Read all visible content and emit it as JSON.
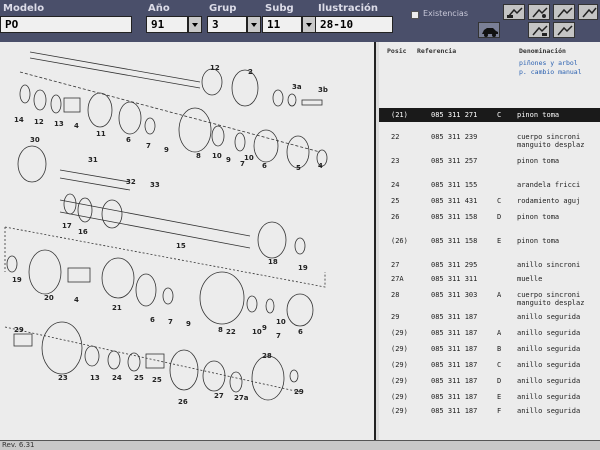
{
  "header": {
    "modelo_label": "Modelo",
    "modelo_value": "PO",
    "ano_label": "Año",
    "ano_value": "91",
    "grup_label": "Grup",
    "grup_value": "3",
    "subg_label": "Subg",
    "subg_value": "11",
    "ilustracion_label": "Ilustración",
    "ilustracion_value": "28-10",
    "existencias_label": "Existencias",
    "toolbar_icons": [
      "car-parts-icon-1",
      "car-parts-icon-2",
      "car-parts-icon-3",
      "car-parts-icon-4",
      "car-parts-icon-5",
      "car-parts-icon-6",
      "car-icon"
    ]
  },
  "drawing": {
    "callouts": [
      "12",
      "2",
      "3a",
      "3b",
      "14",
      "12",
      "13",
      "4",
      "11",
      "6",
      "7",
      "9",
      "8",
      "10",
      "10",
      "9",
      "7",
      "6",
      "5",
      "4",
      "30",
      "31",
      "32",
      "33",
      "17",
      "16",
      "15",
      "18",
      "19",
      "19",
      "20",
      "4",
      "21",
      "6",
      "7",
      "9",
      "8",
      "10",
      "22",
      "10",
      "9",
      "7",
      "6",
      "29",
      "23",
      "13",
      "24",
      "25",
      "28",
      "26",
      "27",
      "27a",
      "29",
      "25"
    ]
  },
  "parts": {
    "header": {
      "pos": "Posic",
      "ref": "Referencia",
      "den": "Denominación"
    },
    "group_desc": [
      "piñones y arbol",
      "p. cambio manual"
    ],
    "rows": [
      {
        "pos": "(21)",
        "ref": "085 311 271",
        "suf": "C",
        "den": "pinon toma",
        "den2": "",
        "selected": true
      },
      {
        "pos": "22",
        "ref": "085 311 239",
        "suf": "",
        "den": "cuerpo sincroni",
        "den2": "manguito desplaz",
        "selected": false
      },
      {
        "pos": "23",
        "ref": "085 311 257",
        "suf": "",
        "den": "pinon toma",
        "den2": "",
        "selected": false
      },
      {
        "pos": "24",
        "ref": "085 311 155",
        "suf": "",
        "den": "arandela fricci",
        "den2": "",
        "selected": false
      },
      {
        "pos": "25",
        "ref": "085 311 431",
        "suf": "C",
        "den": "rodamiento aguj",
        "den2": "",
        "selected": false
      },
      {
        "pos": "26",
        "ref": "085 311 158",
        "suf": "D",
        "den": "pinon toma",
        "den2": "",
        "selected": false
      },
      {
        "pos": "(26)",
        "ref": "085 311 158",
        "suf": "E",
        "den": "pinon toma",
        "den2": "",
        "selected": false
      },
      {
        "pos": "27",
        "ref": "085 311 295",
        "suf": "",
        "den": "anillo sincroni",
        "den2": "",
        "selected": false
      },
      {
        "pos": "27A",
        "ref": "085 311 311",
        "suf": "",
        "den": "muelle",
        "den2": "",
        "selected": false
      },
      {
        "pos": "28",
        "ref": "085 311 303",
        "suf": "A",
        "den": "cuerpo sincroni",
        "den2": "manguito desplaz",
        "selected": false
      },
      {
        "pos": "29",
        "ref": "085 311 187",
        "suf": "",
        "den": "anillo segurida",
        "den2": "",
        "selected": false
      },
      {
        "pos": "(29)",
        "ref": "085 311 187",
        "suf": "A",
        "den": "anillo segurida",
        "den2": "",
        "selected": false
      },
      {
        "pos": "(29)",
        "ref": "085 311 187",
        "suf": "B",
        "den": "anillo segurida",
        "den2": "",
        "selected": false
      },
      {
        "pos": "(29)",
        "ref": "085 311 187",
        "suf": "C",
        "den": "anillo segurida",
        "den2": "",
        "selected": false
      },
      {
        "pos": "(29)",
        "ref": "085 311 187",
        "suf": "D",
        "den": "anillo segurida",
        "den2": "",
        "selected": false
      },
      {
        "pos": "(29)",
        "ref": "085 311 187",
        "suf": "E",
        "den": "anillo segurida",
        "den2": "",
        "selected": false
      },
      {
        "pos": "(29)",
        "ref": "085 311 187",
        "suf": "F",
        "den": "anillo segurida",
        "den2": "",
        "selected": false
      }
    ]
  },
  "footer": {
    "version": "Rev. 6.31"
  }
}
